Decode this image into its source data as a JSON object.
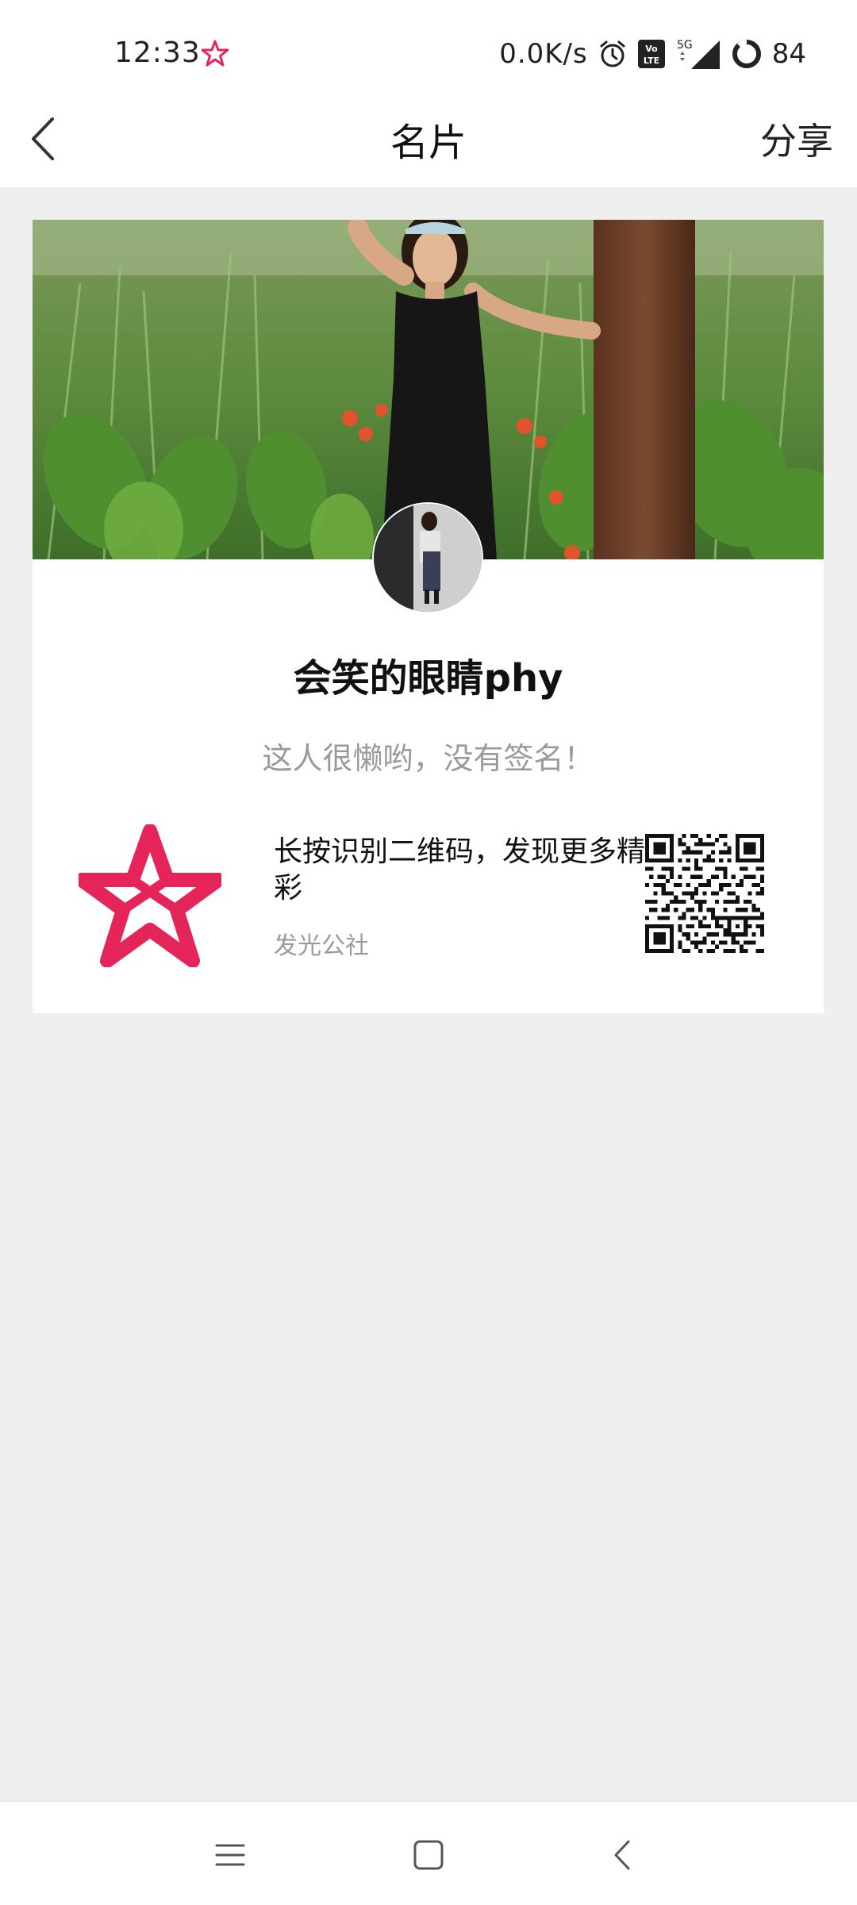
{
  "status_bar": {
    "time": "12:33",
    "app_icon": "star-app-icon",
    "net_speed": "0.0K/s",
    "network": "5G",
    "battery": "84",
    "icons": [
      "alarm-icon",
      "volte-icon",
      "5g-icon",
      "signal-icon",
      "battery-ring-icon"
    ]
  },
  "nav": {
    "title": "名片",
    "share_label": "分享",
    "back_icon": "chevron-left-icon"
  },
  "card": {
    "nickname": "会笑的眼睛phy",
    "signature": "这人很懒哟，没有签名！",
    "promo_text": "长按识别二维码，发现更多精彩",
    "promo_source": "发光公社",
    "logo_icon": "star-logo-icon",
    "brand_color": "#e5245a"
  },
  "system_nav": {
    "menu_icon": "menu-icon",
    "home_icon": "home-square-icon",
    "back_icon": "back-triangle-icon"
  }
}
